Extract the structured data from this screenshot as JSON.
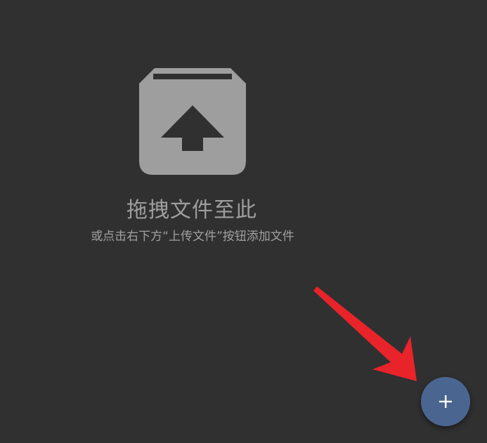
{
  "drop_zone": {
    "icon": "upload-box-icon",
    "title": "拖拽文件至此",
    "subtitle": "或点击右下方“上传文件”按钮添加文件"
  },
  "fab": {
    "icon": "plus-icon"
  },
  "colors": {
    "background": "#303030",
    "icon_gray": "#9e9e9e",
    "fab_blue": "#4a6690",
    "annotation_red": "#e8232a"
  }
}
